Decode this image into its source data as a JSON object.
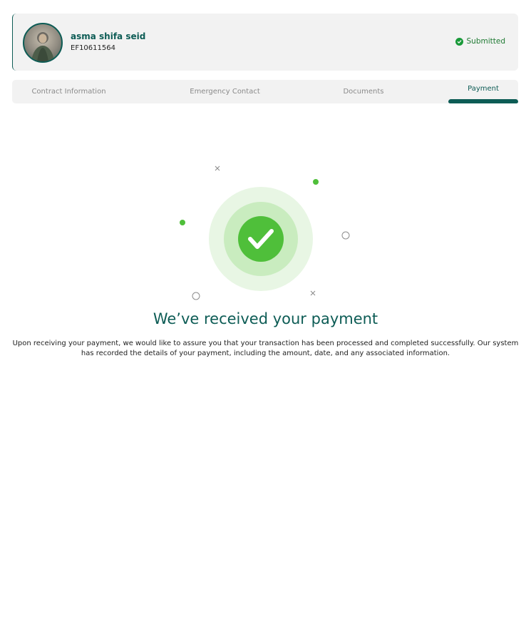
{
  "profile": {
    "name": "asma shifa seid",
    "id": "EF10611564",
    "status": "Submitted",
    "status_color": "#1a9a3a"
  },
  "tabs": [
    {
      "label": "Contract Information",
      "active": false
    },
    {
      "label": "Emergency Contact",
      "active": false
    },
    {
      "label": "Documents",
      "active": false
    },
    {
      "label": "Payment",
      "active": true
    }
  ],
  "main": {
    "title": "We’ve received your payment",
    "description": "Upon receiving your payment, we would like to assure you that your transaction has been processed and completed successfully. Our system has recorded the details of your payment, including the amount, date, and any associated information."
  },
  "theme": {
    "primary": "#0d5c55",
    "success": "#4fbf3a"
  }
}
